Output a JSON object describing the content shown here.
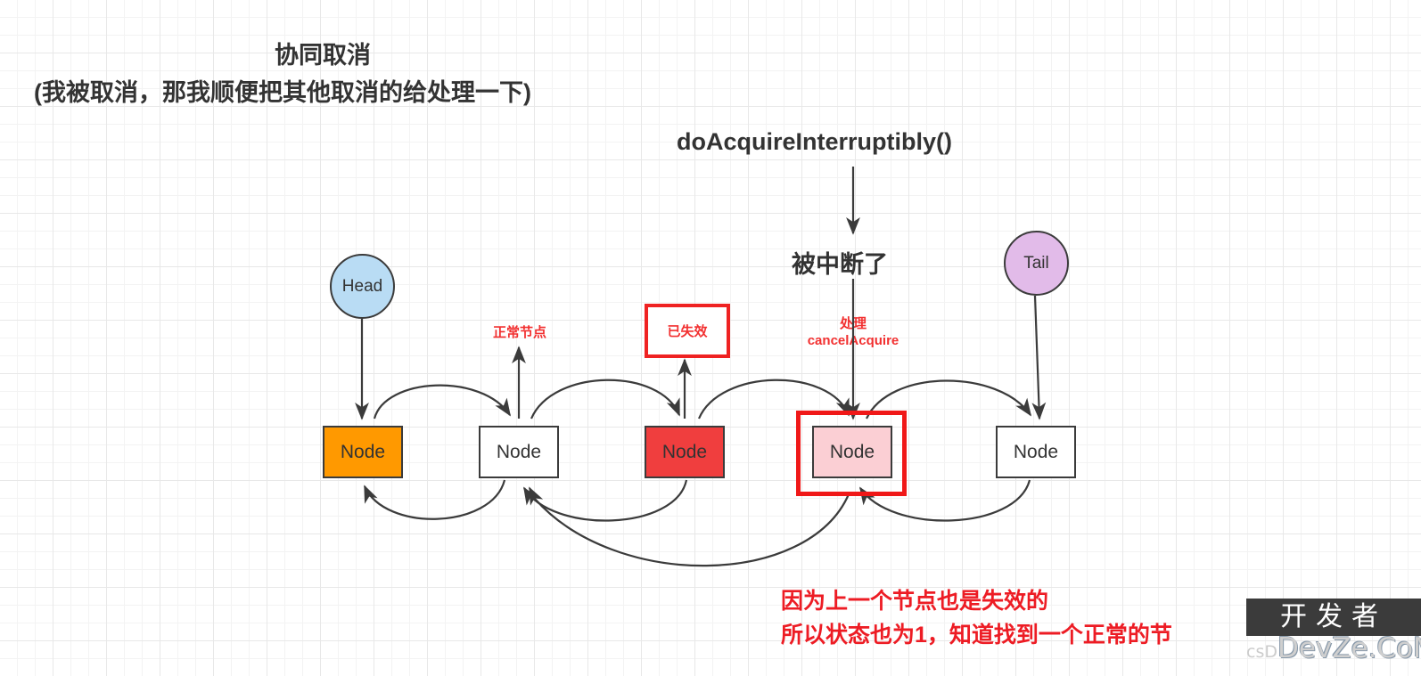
{
  "diagram": {
    "title_lines": [
      "协同取消",
      "(我被取消，那我顺便把其他取消的给处理一下)"
    ],
    "method_label": "doAcquireInterruptibly()",
    "interrupt_label": "被中断了",
    "annotations": {
      "normal_node": "正常节点",
      "invalidated": "已失效",
      "handle_line1": "处理",
      "handle_line2": "cancelAcquire"
    },
    "bottom_note_lines": [
      "因为上一个节点也是失效的",
      "所以状态也为1，知道找到一个正常的节"
    ],
    "endpoints": [
      {
        "id": "head",
        "label": "Head"
      },
      {
        "id": "tail",
        "label": "Tail"
      }
    ],
    "nodes": [
      {
        "id": "node-1",
        "label": "Node",
        "state": "head-node",
        "fill": "#FF9900"
      },
      {
        "id": "node-2",
        "label": "Node",
        "state": "normal",
        "fill": "#FFFFFF"
      },
      {
        "id": "node-3",
        "label": "Node",
        "state": "cancelled",
        "fill": "#F03E3E"
      },
      {
        "id": "node-4",
        "label": "Node",
        "state": "interrupted-highlighted",
        "fill": "#FBCFD4"
      },
      {
        "id": "node-5",
        "label": "Node",
        "state": "normal",
        "fill": "#FFFFFF"
      }
    ],
    "colors": {
      "accent_red": "#ED1C24",
      "label_red": "#F23030",
      "highlight_red": "#F01818",
      "orange_node": "#FF9900",
      "cancelled_node": "#F03E3E",
      "interrupted_node": "#FBCFD4",
      "head_circle": "#B9DCF4",
      "tail_circle": "#E2BBE9",
      "stroke": "#3B3B3B",
      "text": "#333333"
    },
    "watermark": {
      "top": "开发者",
      "prefix": "csD",
      "bottom": "DevZe.CoM"
    }
  }
}
